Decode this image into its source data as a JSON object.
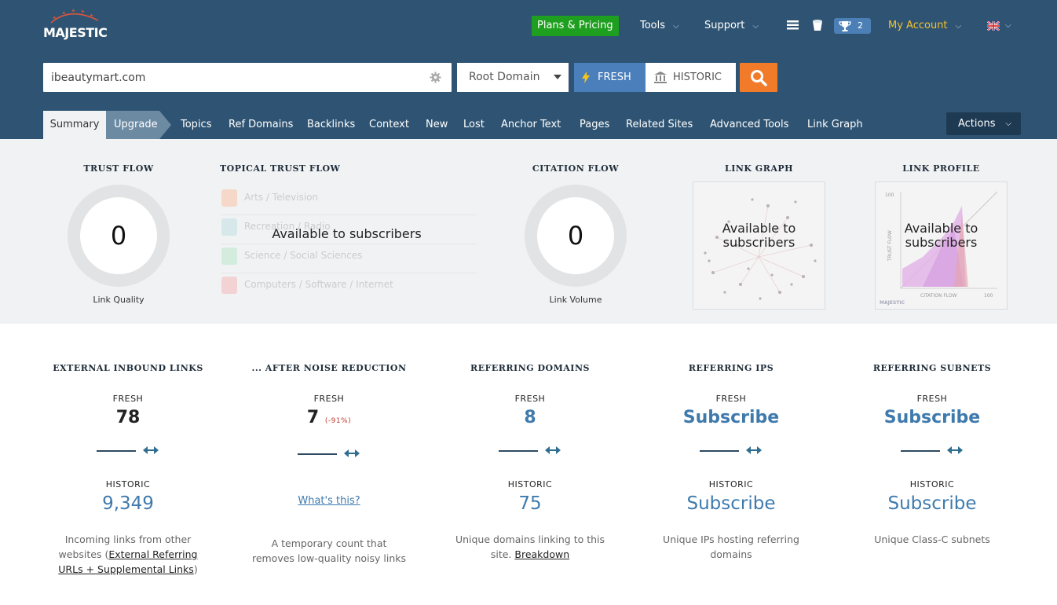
{
  "header": {
    "logo_text": "MAJESTIC",
    "plans_label": "Plans & Pricing",
    "tools_label": "Tools",
    "support_label": "Support",
    "trophy_count": "2",
    "account_label": "My Account",
    "flag_icon": "uk-flag-icon"
  },
  "search": {
    "value": "ibeautymart.com",
    "scope": "Root Domain",
    "fresh_label": "FRESH",
    "historic_label": "HISTORIC"
  },
  "tabs": [
    {
      "label": "Summary"
    },
    {
      "label": "Upgrade"
    },
    {
      "label": "Topics"
    },
    {
      "label": "Ref Domains"
    },
    {
      "label": "Backlinks"
    },
    {
      "label": "Context"
    },
    {
      "label": "New"
    },
    {
      "label": "Lost"
    },
    {
      "label": "Anchor Text"
    },
    {
      "label": "Pages"
    },
    {
      "label": "Related Sites"
    },
    {
      "label": "Advanced Tools"
    },
    {
      "label": "Link Graph"
    }
  ],
  "actions_label": "Actions",
  "summary": {
    "trust_flow": {
      "title": "TRUST FLOW",
      "value": "0",
      "caption": "Link Quality"
    },
    "topical_trust_flow": {
      "title": "TOPICAL TRUST FLOW",
      "overlay": "Available to subscribers",
      "topics": [
        {
          "label": "Arts / Television",
          "color": "#f6d8c8"
        },
        {
          "label": "Recreation / Radio",
          "color": "#d6e8ea"
        },
        {
          "label": "Science / Social Sciences",
          "color": "#d4ecde"
        },
        {
          "label": "Computers / Software / Internet",
          "color": "#f3d2d4"
        }
      ]
    },
    "citation_flow": {
      "title": "CITATION FLOW",
      "value": "0",
      "caption": "Link Volume"
    },
    "link_graph": {
      "title": "LINK GRAPH",
      "overlay": "Available to subscribers"
    },
    "link_profile": {
      "title": "LINK PROFILE",
      "overlay": "Available to subscribers",
      "axis_y": "TRUST FLOW",
      "axis_x": "CITATION FLOW",
      "tick_100": "100",
      "brand": "MAJESTIC"
    }
  },
  "stats": {
    "fresh_label": "FRESH",
    "historic_label": "HISTORIC",
    "external_inbound": {
      "title": "EXTERNAL INBOUND LINKS",
      "fresh": "78",
      "historic": "9,349",
      "desc_prefix": "Incoming links from other websites (",
      "desc_link": "External Referring URLs + Supplemental Links",
      "desc_suffix": ")"
    },
    "after_noise": {
      "title": "... AFTER NOISE REDUCTION",
      "fresh": "7",
      "fresh_pct": "(-91%)",
      "historic_link": "What's this?",
      "desc": "A temporary count that removes low-quality noisy links"
    },
    "referring_domains": {
      "title": "REFERRING DOMAINS",
      "fresh": "8",
      "historic": "75",
      "desc_prefix": "Unique domains linking to this site. ",
      "desc_link": "Breakdown"
    },
    "referring_ips": {
      "title": "REFERRING IPS",
      "fresh": "Subscribe",
      "historic": "Subscribe",
      "desc": "Unique IPs hosting referring domains"
    },
    "referring_subnets": {
      "title": "REFERRING SUBNETS",
      "fresh": "Subscribe",
      "historic": "Subscribe",
      "desc": "Unique Class-C subnets"
    }
  },
  "colors": {
    "header_bg": "#2f5473",
    "accent_orange": "#f27b2a",
    "plans_green": "#1f9f1f",
    "fresh_blue": "#4a7fbb",
    "value_blue": "#3f7aad",
    "account_yellow": "#f2c12e"
  }
}
